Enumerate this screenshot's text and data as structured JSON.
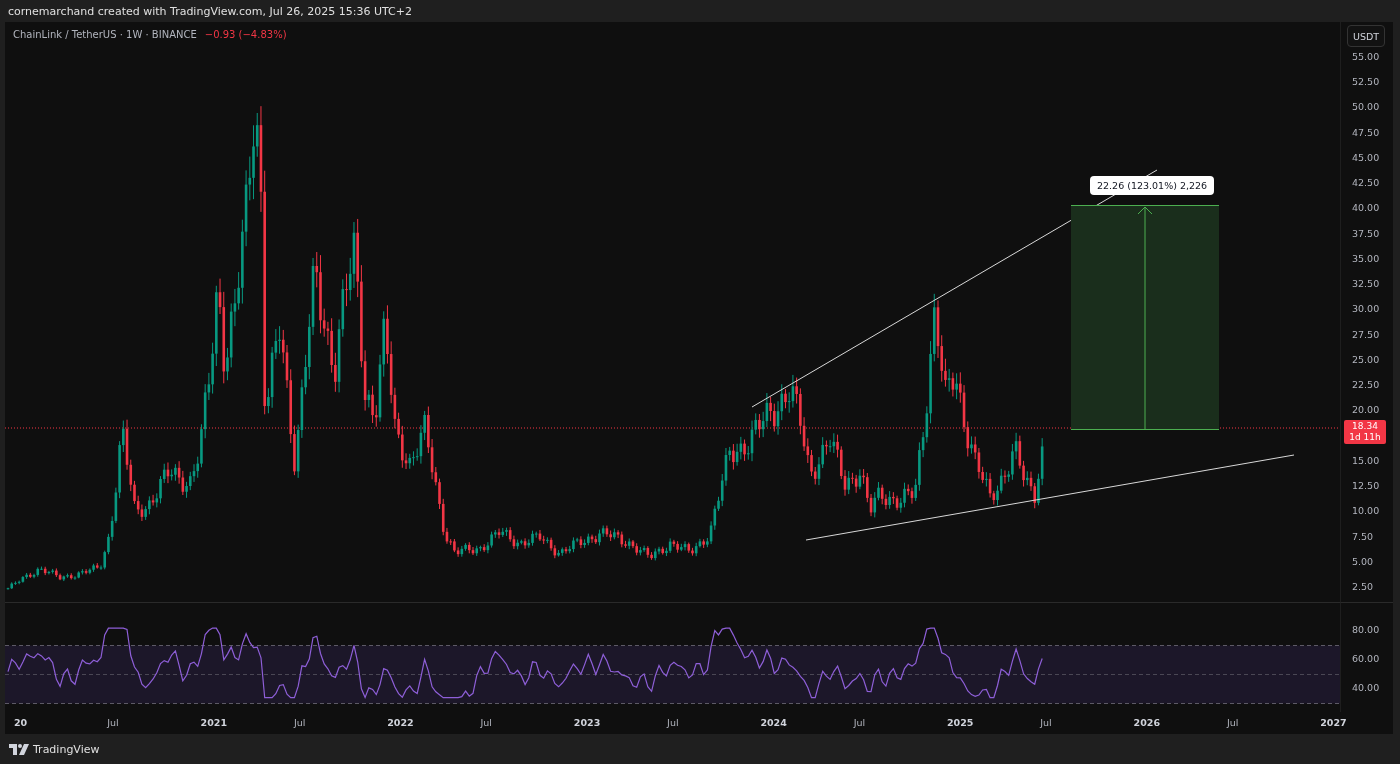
{
  "caption": "cornemarchand created with TradingView.com, Jul 26, 2025 15:36 UTC+2",
  "symbol": {
    "title": "ChainLink / TetherUS · 1W · BINANCE",
    "change": "−0.93 (−4.83%)",
    "falling": true
  },
  "currency_button": "USDT",
  "price_axis_upper": [
    "55.00",
    "52.50",
    "50.00",
    "47.50",
    "45.00",
    "42.50",
    "40.00",
    "37.50",
    "35.00",
    "32.50",
    "30.00",
    "27.50",
    "25.00",
    "22.50",
    "20.00"
  ],
  "price_axis_lower": [
    "15.00",
    "12.50",
    "10.00",
    "7.50",
    "5.00",
    "2.50"
  ],
  "last_price": {
    "price": "18.34",
    "countdown": "1d 11h",
    "falling": true
  },
  "measure_label": "22.26 (123.01%) 2,226",
  "rsi_axis": [
    "80.00",
    "60.00",
    "40.00"
  ],
  "time_axis": [
    {
      "label": "20",
      "kind": "year"
    },
    {
      "label": "Jul",
      "kind": "month"
    },
    {
      "label": "2021",
      "kind": "year"
    },
    {
      "label": "Jul",
      "kind": "month"
    },
    {
      "label": "2022",
      "kind": "year"
    },
    {
      "label": "Jul",
      "kind": "month"
    },
    {
      "label": "2023",
      "kind": "year"
    },
    {
      "label": "Jul",
      "kind": "month"
    },
    {
      "label": "2024",
      "kind": "year"
    },
    {
      "label": "Jul",
      "kind": "month"
    },
    {
      "label": "2025",
      "kind": "year"
    },
    {
      "label": "Jul",
      "kind": "month"
    },
    {
      "label": "2026",
      "kind": "year"
    },
    {
      "label": "Jul",
      "kind": "month"
    },
    {
      "label": "2027",
      "kind": "year"
    }
  ],
  "brand": "TradingView"
}
